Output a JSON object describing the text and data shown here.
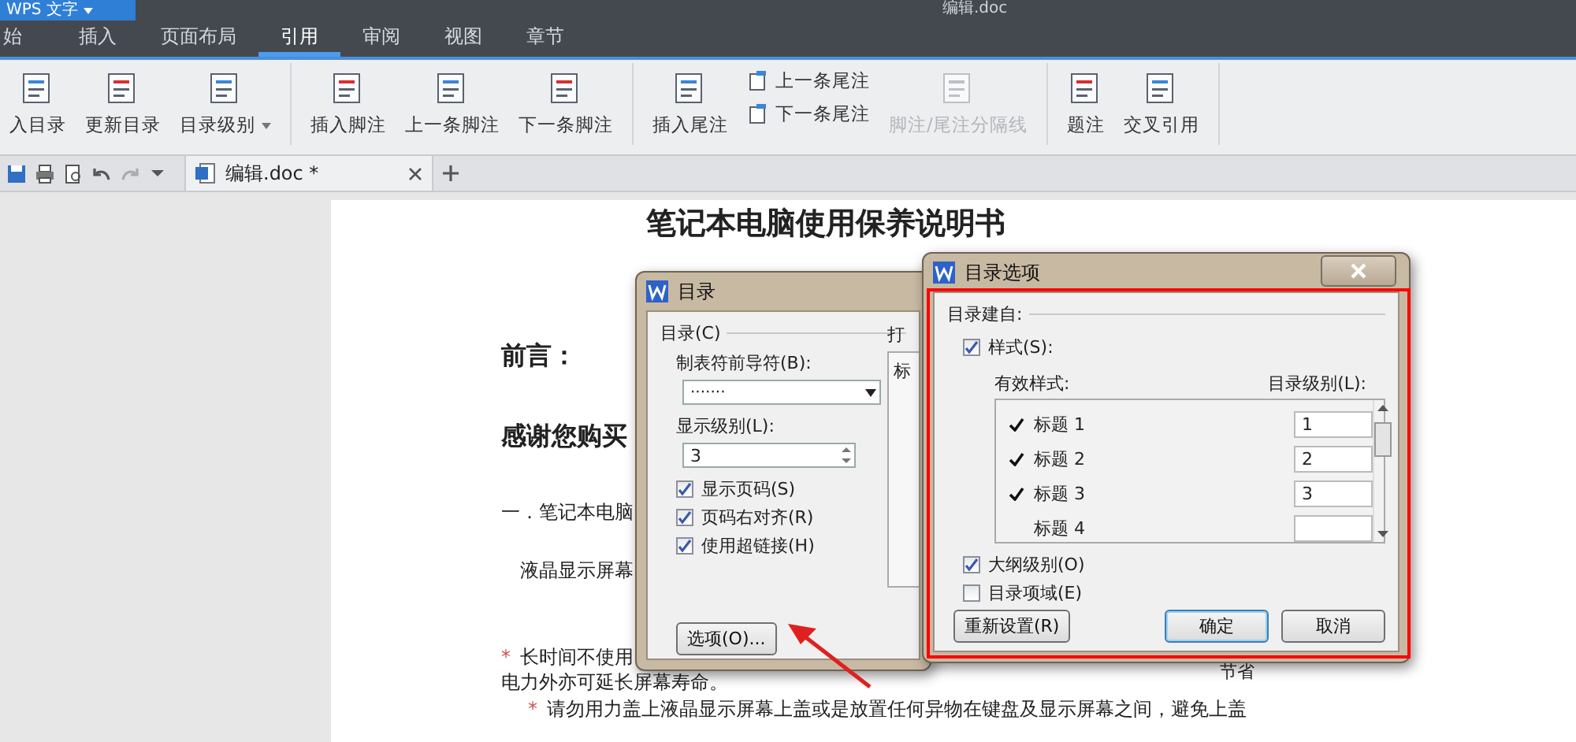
{
  "app": {
    "menu_button": "WPS 文字",
    "document_title": "编辑.doc"
  },
  "tabs": [
    {
      "label": "始",
      "selected": false
    },
    {
      "label": "插入",
      "selected": false
    },
    {
      "label": "页面布局",
      "selected": false
    },
    {
      "label": "引用",
      "selected": true
    },
    {
      "label": "审阅",
      "selected": false
    },
    {
      "label": "视图",
      "selected": false
    },
    {
      "label": "章节",
      "selected": false
    }
  ],
  "ribbon": {
    "groups": [
      {
        "items": [
          {
            "label": "入目录",
            "kind": "large",
            "disabled": false,
            "dropdown": false
          },
          {
            "label": "更新目录",
            "kind": "large",
            "disabled": false,
            "dropdown": false
          },
          {
            "label": "目录级别",
            "kind": "large",
            "disabled": false,
            "dropdown": true
          }
        ]
      },
      {
        "items": [
          {
            "label": "插入脚注",
            "kind": "large",
            "disabled": false,
            "dropdown": false
          },
          {
            "label": "上一条脚注",
            "kind": "large",
            "disabled": false,
            "dropdown": false
          },
          {
            "label": "下一条脚注",
            "kind": "large",
            "disabled": false,
            "dropdown": false
          }
        ]
      },
      {
        "items": [
          {
            "label": "插入尾注",
            "kind": "large",
            "disabled": false,
            "dropdown": false
          },
          {
            "label": "上一条尾注",
            "kind": "small",
            "disabled": false,
            "dropdown": false
          },
          {
            "label": "下一条尾注",
            "kind": "small",
            "disabled": false,
            "dropdown": false
          },
          {
            "label": "脚注/尾注分隔线",
            "kind": "large",
            "disabled": true,
            "dropdown": false
          }
        ]
      },
      {
        "items": [
          {
            "label": "题注",
            "kind": "large",
            "disabled": false,
            "dropdown": false
          },
          {
            "label": "交叉引用",
            "kind": "large",
            "disabled": false,
            "dropdown": false
          }
        ]
      }
    ]
  },
  "document_tab": {
    "label": "编辑.doc *"
  },
  "document": {
    "lines": [
      {
        "kind": "title",
        "text": "笔记本电脑使用保养说明书"
      },
      {
        "kind": "heading",
        "text": "前言："
      },
      {
        "kind": "heading",
        "text": "感谢您购买"
      },
      {
        "kind": "body",
        "text": "一．笔记本电脑"
      },
      {
        "kind": "indent",
        "text": "液晶显示屏幕"
      },
      {
        "kind": "bullet",
        "marker": "*",
        "text": "长时间不使用",
        "tail": "节省"
      },
      {
        "kind": "continuation",
        "text": "电力外亦可延长屏幕寿命。"
      },
      {
        "kind": "subbullet",
        "marker": "*",
        "text": "请勿用力盖上液晶显示屏幕上盖或是放置任何异物在键盘及显示屏幕之间，避免上盖"
      }
    ]
  },
  "toc_dialog": {
    "title": "目录",
    "section": "目录(C)",
    "leader_label": "制表符前导符(B):",
    "leader_value": "·······",
    "level_label": "显示级别(L):",
    "level_value": "3",
    "options": [
      {
        "label": "显示页码(S)",
        "checked": true
      },
      {
        "label": "页码右对齐(R)",
        "checked": true
      },
      {
        "label": "使用超链接(H)",
        "checked": true
      }
    ],
    "options_button": "选项(O)...",
    "preview_label": "打",
    "preview_text": "标"
  },
  "options_dialog": {
    "title": "目录选项",
    "section": "目录建自:",
    "styles_checkbox": {
      "label": "样式(S):",
      "checked": true
    },
    "styles_header": "有效样式:",
    "level_header": "目录级别(L):",
    "styles": [
      {
        "name": "标题 1",
        "checked": true,
        "toc_level": "1"
      },
      {
        "name": "标题 2",
        "checked": true,
        "toc_level": "2"
      },
      {
        "name": "标题 3",
        "checked": true,
        "toc_level": "3"
      },
      {
        "name": "标题 4",
        "checked": false
      }
    ],
    "checkboxes": [
      {
        "label": "大纲级别(O)",
        "checked": true
      },
      {
        "label": "目录项域(E)",
        "checked": false
      }
    ],
    "buttons": [
      {
        "label": "重新设置(R)",
        "kind": "normal"
      },
      {
        "label": "确定",
        "kind": "default"
      },
      {
        "label": "取消",
        "kind": "normal"
      }
    ]
  }
}
